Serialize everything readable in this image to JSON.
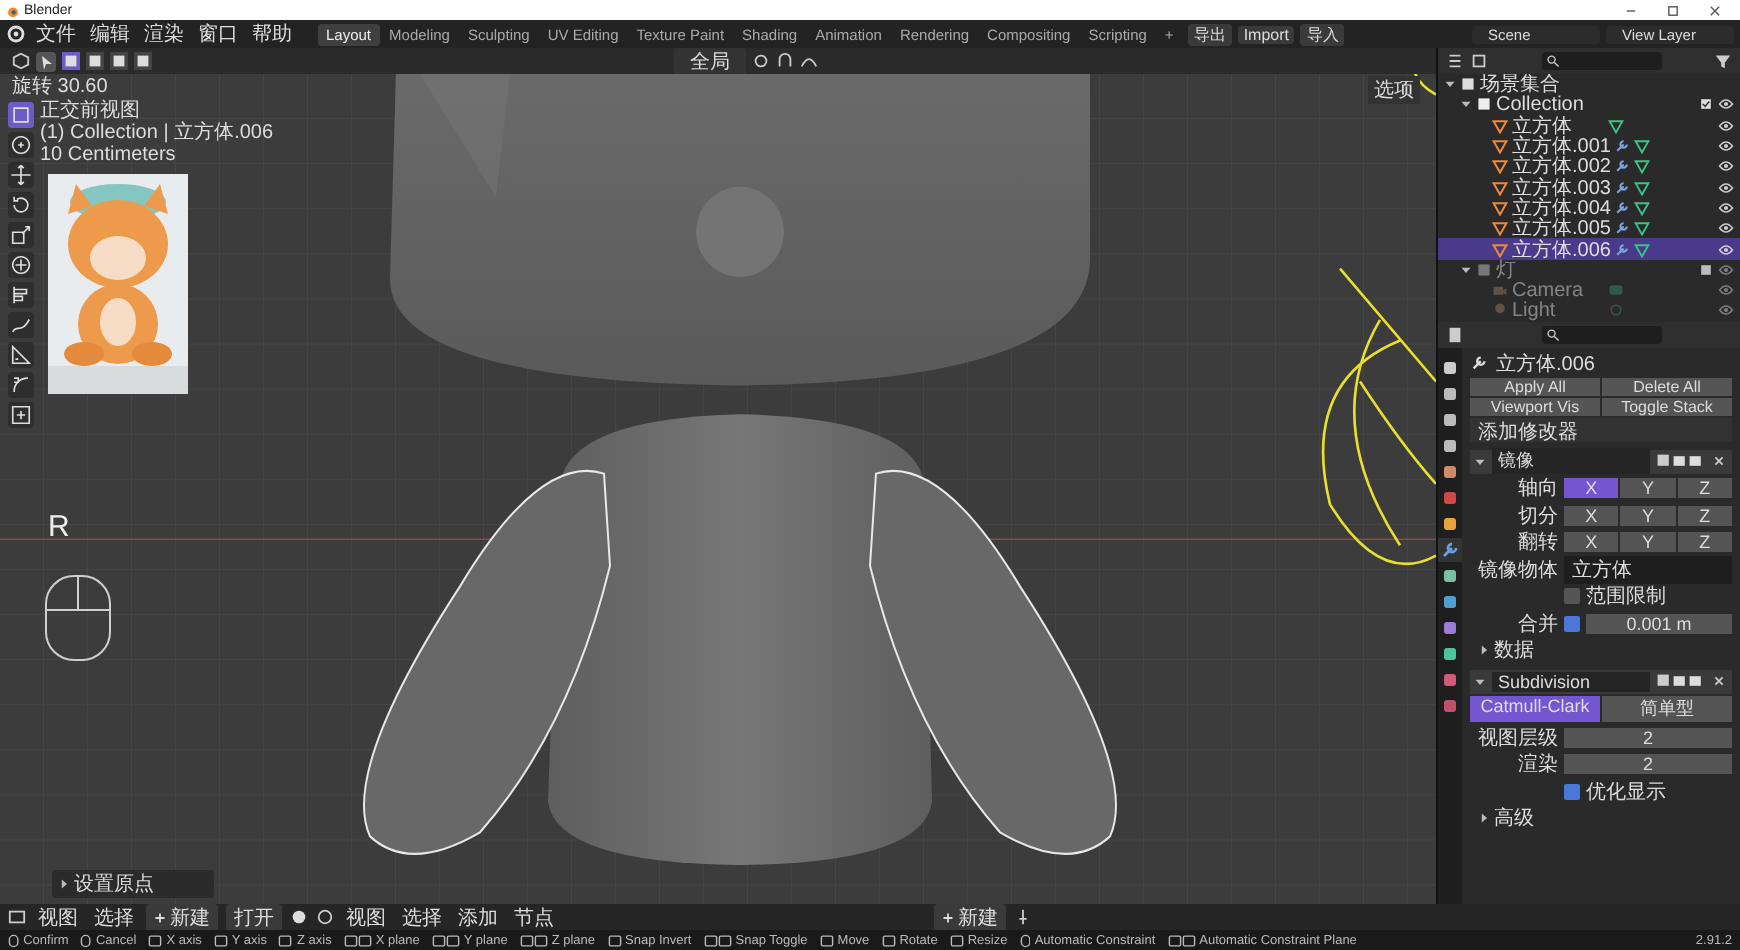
{
  "window": {
    "title": "Blender"
  },
  "menu": [
    "文件",
    "编辑",
    "渲染",
    "窗口",
    "帮助"
  ],
  "workspaces": [
    {
      "label": "Layout",
      "selected": true
    },
    {
      "label": "Modeling",
      "selected": false
    },
    {
      "label": "Sculpting",
      "selected": false
    },
    {
      "label": "UV Editing",
      "selected": false
    },
    {
      "label": "Texture Paint",
      "selected": false
    },
    {
      "label": "Shading",
      "selected": false
    },
    {
      "label": "Animation",
      "selected": false
    },
    {
      "label": "Rendering",
      "selected": false
    },
    {
      "label": "Compositing",
      "selected": false
    },
    {
      "label": "Scripting",
      "selected": false
    }
  ],
  "add_workspace": "+",
  "file_buttons": [
    "导出",
    "Import",
    "导入"
  ],
  "scene": "Scene",
  "view_layer": "View Layer",
  "viewport": {
    "select_modes": [
      {
        "selected": true
      },
      {
        "selected": false
      },
      {
        "selected": false
      },
      {
        "selected": false
      }
    ],
    "orientation": "全局",
    "options": "选项",
    "zoom_readout": "旋转 30.60",
    "view_name": "正交前视图",
    "object_info": "(1) Collection | 立方体.006",
    "grid_scale": "10 Centimeters",
    "key_hint": "R",
    "last_operator": "设置原点",
    "tools": [
      {
        "kind": "select",
        "selected": true
      },
      {
        "kind": "cursor",
        "selected": false
      },
      {
        "kind": "move",
        "selected": false
      },
      {
        "kind": "rotate",
        "selected": false
      },
      {
        "kind": "scale",
        "selected": false
      },
      {
        "kind": "transform",
        "selected": false
      },
      {
        "kind": "align",
        "selected": false
      },
      {
        "kind": "annotate",
        "selected": false
      },
      {
        "kind": "measure",
        "selected": false
      },
      {
        "kind": "curve",
        "selected": false
      },
      {
        "kind": "add",
        "selected": false
      }
    ]
  },
  "outliner": {
    "items": [
      {
        "name": "场景集合",
        "kind": "scene_collection",
        "children": [
          {
            "name": "Collection",
            "kind": "collection",
            "excluded": false,
            "children": [
              {
                "name": "立方体",
                "kind": "mesh",
                "modifier": false,
                "selected": false
              },
              {
                "name": "立方体.001",
                "kind": "mesh",
                "modifier": true,
                "selected": false
              },
              {
                "name": "立方体.002",
                "kind": "mesh",
                "modifier": true,
                "selected": false
              },
              {
                "name": "立方体.003",
                "kind": "mesh",
                "modifier": true,
                "selected": false
              },
              {
                "name": "立方体.004",
                "kind": "mesh",
                "modifier": true,
                "selected": false
              },
              {
                "name": "立方体.005",
                "kind": "mesh",
                "modifier": true,
                "selected": false
              },
              {
                "name": "立方体.006",
                "kind": "mesh",
                "modifier": true,
                "selected": true
              }
            ]
          },
          {
            "name": "灯",
            "kind": "collection",
            "excluded": true,
            "children": [
              {
                "name": "Camera",
                "kind": "camera",
                "selected": false
              },
              {
                "name": "Light",
                "kind": "light",
                "selected": false
              }
            ]
          }
        ]
      }
    ]
  },
  "properties": {
    "tabs": [
      {
        "kind": "tool",
        "selected": false
      },
      {
        "kind": "render",
        "selected": false
      },
      {
        "kind": "output",
        "selected": false
      },
      {
        "kind": "view_layer",
        "selected": false
      },
      {
        "kind": "scene",
        "selected": false
      },
      {
        "kind": "world",
        "selected": false
      },
      {
        "kind": "object",
        "selected": false
      },
      {
        "kind": "modifier",
        "selected": true
      },
      {
        "kind": "particles",
        "selected": false
      },
      {
        "kind": "physics",
        "selected": false
      },
      {
        "kind": "constraint",
        "selected": false
      },
      {
        "kind": "data",
        "selected": false
      },
      {
        "kind": "material",
        "selected": false
      },
      {
        "kind": "texture",
        "selected": false
      }
    ],
    "object_name": "立方体.006",
    "stack_buttons": [
      "Apply All",
      "Delete All",
      "Viewport Vis",
      "Toggle Stack"
    ],
    "add_modifier": "添加修改器",
    "modifiers": [
      {
        "kind": "mirror",
        "name": "镜像",
        "expanded": true,
        "axis_rows": [
          {
            "label": "轴向",
            "axes": [
              {
                "label": "X",
                "selected": true
              },
              {
                "label": "Y",
                "selected": false
              },
              {
                "label": "Z",
                "selected": false
              }
            ]
          },
          {
            "label": "切分",
            "axes": [
              {
                "label": "X",
                "selected": false
              },
              {
                "label": "Y",
                "selected": false
              },
              {
                "label": "Z",
                "selected": false
              }
            ]
          },
          {
            "label": "翻转",
            "axes": [
              {
                "label": "X",
                "selected": false
              },
              {
                "label": "Y",
                "selected": false
              },
              {
                "label": "Z",
                "selected": false
              }
            ]
          }
        ],
        "mirror_object_label": "镜像物体",
        "mirror_object": "立方体",
        "clipping": {
          "label": "范围限制",
          "checked": false
        },
        "merge": {
          "label": "合并",
          "checked": true,
          "value": "0.001 m"
        },
        "subpanel": "数据"
      },
      {
        "kind": "subdivision",
        "name": "Subdivision",
        "expanded": true,
        "methods": [
          {
            "label": "Catmull-Clark",
            "selected": true
          },
          {
            "label": "简单型",
            "selected": false
          }
        ],
        "levels": [
          {
            "label": "视图层级",
            "value": "2"
          },
          {
            "label": "渲染",
            "value": "2"
          }
        ],
        "optimal": {
          "label": "优化显示",
          "checked": true
        },
        "subpanel": "高级"
      }
    ]
  },
  "bottom_header": {
    "menus_left": [
      "视图",
      "选择"
    ],
    "new": "新建",
    "open": "打开",
    "menus_right": [
      "视图",
      "选择",
      "添加",
      "节点"
    ],
    "new_right": "新建"
  },
  "status": [
    {
      "kind": "mouse",
      "label": "Confirm"
    },
    {
      "kind": "mouse",
      "label": "Cancel"
    },
    {
      "kind": "key",
      "label": "X axis"
    },
    {
      "kind": "key",
      "label": "Y axis"
    },
    {
      "kind": "key",
      "label": "Z axis"
    },
    {
      "kind": "shift_key",
      "label": "X plane"
    },
    {
      "kind": "shift_key",
      "label": "Y plane"
    },
    {
      "kind": "shift_key",
      "label": "Z plane"
    },
    {
      "kind": "key",
      "label": "Snap Invert"
    },
    {
      "kind": "shift_key",
      "label": "Snap Toggle"
    },
    {
      "kind": "key",
      "label": "Move"
    },
    {
      "kind": "key",
      "label": "Rotate"
    },
    {
      "kind": "key",
      "label": "Resize"
    },
    {
      "kind": "mouse",
      "label": "Automatic Constraint"
    },
    {
      "kind": "shift_key",
      "label": "Automatic Constraint Plane"
    }
  ],
  "version": "2.91.2"
}
